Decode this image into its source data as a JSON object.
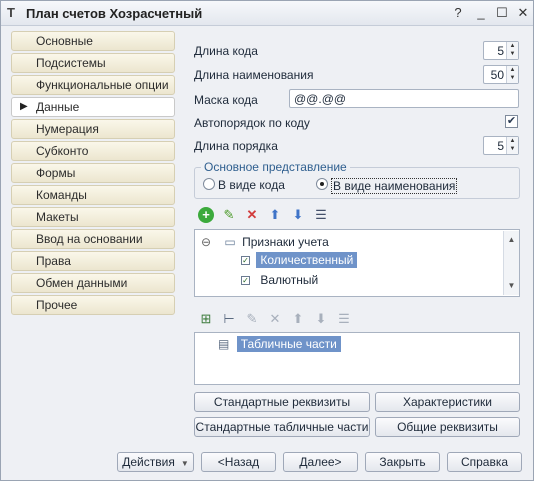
{
  "window": {
    "title": "План счетов Хозрасчетный",
    "app_icon": "Т"
  },
  "sidebar": {
    "items": [
      {
        "label": "Основные"
      },
      {
        "label": "Подсистемы"
      },
      {
        "label": "Функциональные опции"
      },
      {
        "label": "Данные",
        "active": true
      },
      {
        "label": "Нумерация"
      },
      {
        "label": "Субконто"
      },
      {
        "label": "Формы"
      },
      {
        "label": "Команды"
      },
      {
        "label": "Макеты"
      },
      {
        "label": "Ввод на основании"
      },
      {
        "label": "Права"
      },
      {
        "label": "Обмен данными"
      },
      {
        "label": "Прочее"
      }
    ]
  },
  "fields": {
    "code_length": {
      "label": "Длина кода",
      "value": "5"
    },
    "name_length": {
      "label": "Длина наименования",
      "value": "50"
    },
    "code_mask": {
      "label": "Маска кода",
      "value": "@@.@@"
    },
    "auto_order": {
      "label": "Автопорядок по коду",
      "checked": true
    },
    "order_length": {
      "label": "Длина порядка",
      "value": "5"
    }
  },
  "representation": {
    "title": "Основное представление",
    "options": [
      {
        "label": "В виде кода",
        "selected": false
      },
      {
        "label": "В виде наименования",
        "selected": true
      }
    ]
  },
  "attributes_tree": {
    "root": "Признаки учета",
    "children": [
      {
        "label": "Количественный",
        "selected": true
      },
      {
        "label": "Валютный",
        "selected": false
      }
    ]
  },
  "tabular_tree": {
    "items": [
      {
        "label": "Табличные части",
        "selected": true
      }
    ]
  },
  "buttons": {
    "standard_attrs": "Стандартные реквизиты",
    "characteristics": "Характеристики",
    "standard_tabular": "Стандартные табличные части",
    "common_attrs": "Общие реквизиты"
  },
  "footer": {
    "actions": "Действия",
    "back": "<Назад",
    "next": "Далее>",
    "close": "Закрыть",
    "help": "Справка"
  },
  "colors": {
    "selection": "#6f93c9",
    "sidebar_bg": "#ece6cf",
    "window_bg": "#eef0f4"
  }
}
